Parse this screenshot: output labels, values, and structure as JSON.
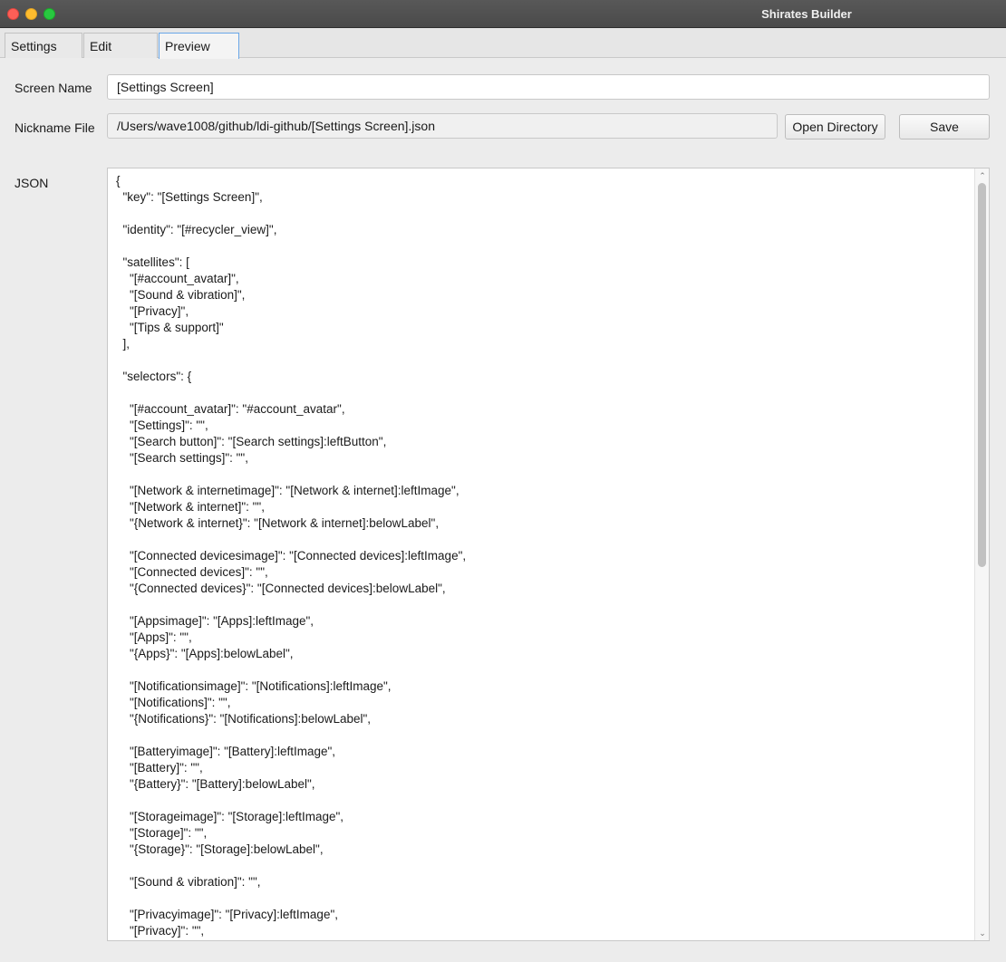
{
  "window": {
    "title": "Shirates Builder"
  },
  "tabs": [
    {
      "label": "Settings"
    },
    {
      "label": "Edit"
    },
    {
      "label": "Preview"
    }
  ],
  "form": {
    "screen_name_label": "Screen Name",
    "screen_name_value": "[Settings Screen]",
    "nickname_file_label": "Nickname File",
    "nickname_file_value": "/Users/wave1008/github/ldi-github/[Settings Screen].json",
    "open_directory_label": "Open Directory",
    "save_label": "Save",
    "json_label": "JSON"
  },
  "json_text": "{\n  \"key\": \"[Settings Screen]\",\n\n  \"identity\": \"[#recycler_view]\",\n\n  \"satellites\": [\n    \"[#account_avatar]\",\n    \"[Sound & vibration]\",\n    \"[Privacy]\",\n    \"[Tips & support]\"\n  ],\n\n  \"selectors\": {\n\n    \"[#account_avatar]\": \"#account_avatar\",\n    \"[Settings]\": \"\",\n    \"[Search button]\": \"[Search settings]:leftButton\",\n    \"[Search settings]\": \"\",\n\n    \"[Network & internetimage]\": \"[Network & internet]:leftImage\",\n    \"[Network & internet]\": \"\",\n    \"{Network & internet}\": \"[Network & internet]:belowLabel\",\n\n    \"[Connected devicesimage]\": \"[Connected devices]:leftImage\",\n    \"[Connected devices]\": \"\",\n    \"{Connected devices}\": \"[Connected devices]:belowLabel\",\n\n    \"[Appsimage]\": \"[Apps]:leftImage\",\n    \"[Apps]\": \"\",\n    \"{Apps}\": \"[Apps]:belowLabel\",\n\n    \"[Notificationsimage]\": \"[Notifications]:leftImage\",\n    \"[Notifications]\": \"\",\n    \"{Notifications}\": \"[Notifications]:belowLabel\",\n\n    \"[Batteryimage]\": \"[Battery]:leftImage\",\n    \"[Battery]\": \"\",\n    \"{Battery}\": \"[Battery]:belowLabel\",\n\n    \"[Storageimage]\": \"[Storage]:leftImage\",\n    \"[Storage]\": \"\",\n    \"{Storage}\": \"[Storage]:belowLabel\",\n\n    \"[Sound & vibration]\": \"\",\n\n    \"[Privacyimage]\": \"[Privacy]:leftImage\",\n    \"[Privacy]\": \"\","
}
